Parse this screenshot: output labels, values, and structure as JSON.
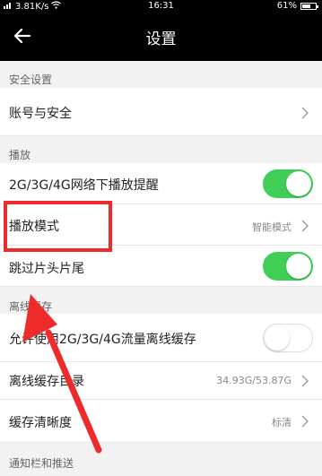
{
  "status_bar": {
    "signal_text": "ill",
    "network_speed": "3.81K/s",
    "time": "16:31",
    "battery_percent": "61%",
    "battery_level": 0.61
  },
  "header": {
    "title": "设置",
    "back_icon": "back-arrow-icon"
  },
  "sections": {
    "security": {
      "title": "安全设置",
      "items": [
        {
          "label": "账号与安全"
        }
      ]
    },
    "playback": {
      "title": "播放",
      "items": [
        {
          "label": "2G/3G/4G网络下播放提醒",
          "toggle": true
        },
        {
          "label": "播放模式",
          "value": "智能模式"
        },
        {
          "label": "跳过片头片尾",
          "toggle": true
        }
      ]
    },
    "offline": {
      "title": "离线缓存",
      "items": [
        {
          "label": "允许使用2G/3G/4G流量离线缓存",
          "toggle": false
        },
        {
          "label": "离线缓存目录",
          "value": "34.93G/53.87G"
        },
        {
          "label": "缓存清晰度",
          "value": "标清"
        }
      ]
    },
    "notify": {
      "title": "通知栏和推送"
    }
  },
  "colors": {
    "toggle_on": "#3fce56",
    "annotation_red": "#ee2b2b"
  }
}
